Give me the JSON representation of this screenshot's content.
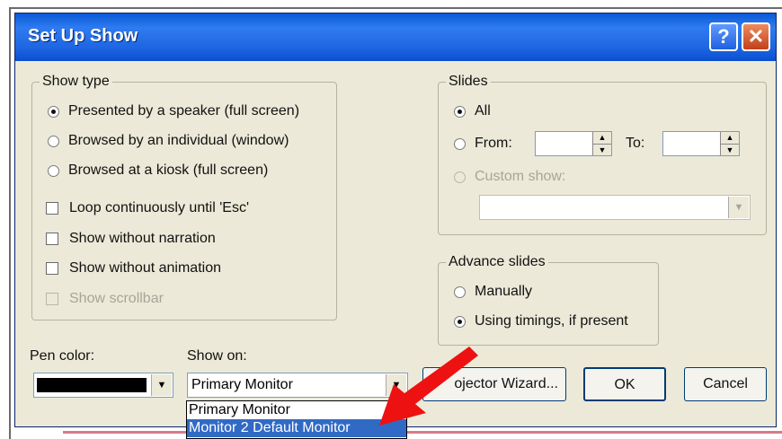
{
  "window": {
    "title": "Set Up Show",
    "help_glyph": "?",
    "close_glyph": "✕"
  },
  "show_type": {
    "legend": "Show type",
    "options": [
      "Presented by a speaker (full screen)",
      "Browsed by an individual (window)",
      "Browsed at a kiosk (full screen)"
    ],
    "selected": 0,
    "checks": [
      "Loop continuously until 'Esc'",
      "Show without narration",
      "Show without animation",
      "Show scrollbar"
    ]
  },
  "slides": {
    "legend": "Slides",
    "all_label": "All",
    "from_label": "From:",
    "to_label": "To:",
    "from_value": "",
    "to_value": "",
    "custom_label": "Custom show:",
    "custom_value": ""
  },
  "advance": {
    "legend": "Advance slides",
    "manually_label": "Manually",
    "timings_label": "Using timings, if present"
  },
  "pen": {
    "label": "Pen color:",
    "color": "#000000"
  },
  "show_on": {
    "label": "Show on:",
    "value": "Primary Monitor",
    "options": [
      "Primary Monitor",
      "Monitor 2 Default Monitor"
    ],
    "highlighted": 1
  },
  "buttons": {
    "projector": "ojector Wizard...",
    "ok": "OK",
    "cancel": "Cancel"
  },
  "colors": {
    "titlebar": "#0a5ad6",
    "dialog_bg": "#ece9d8",
    "highlight": "#316ac5",
    "annotation_arrow": "#ee1111"
  },
  "icons": [
    "help-icon",
    "close-icon",
    "chevron-down-icon",
    "spin-up-icon",
    "spin-down-icon",
    "red-arrow-annotation"
  ]
}
